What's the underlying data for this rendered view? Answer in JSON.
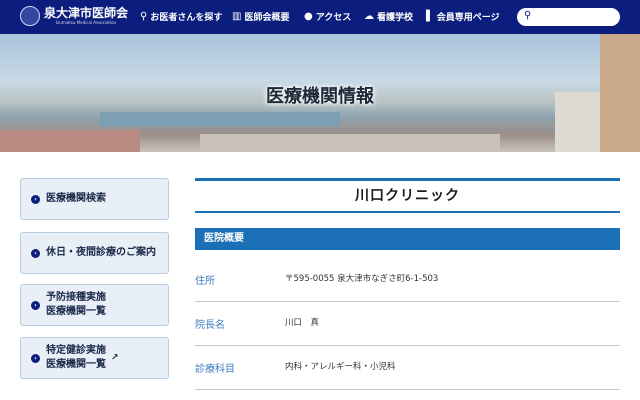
{
  "header": {
    "logo_name": "泉大津市医師会",
    "logo_sub": "Izumiotsu Medical Association",
    "nav": [
      {
        "icon": "search-icon",
        "label": "お医者さんを探す"
      },
      {
        "icon": "building-icon",
        "label": "医師会概要"
      },
      {
        "icon": "pin-icon",
        "label": "アクセス"
      },
      {
        "icon": "cloud-icon",
        "label": "看護学校"
      },
      {
        "icon": "door-icon",
        "label": "会員専用ページ"
      }
    ],
    "search_placeholder": ""
  },
  "hero": {
    "title": "医療機関情報"
  },
  "sidebar": [
    {
      "label": "医療機関検索"
    },
    {
      "label": "休日・夜間診療のご案内"
    },
    {
      "label": "予防接種実施\n医療機関一覧"
    },
    {
      "label": "特定健診実施\n医療機関一覧",
      "external": true
    }
  ],
  "main": {
    "clinic_name": "川口クリニック",
    "section": "医院概要",
    "rows": [
      {
        "label": "住所",
        "value": "〒595-0055 泉大津市なぎさ町6-1-503"
      },
      {
        "label": "院長名",
        "value": "川口　真"
      },
      {
        "label": "診療科目",
        "value": "内科・アレルギー科・小児科"
      }
    ]
  }
}
